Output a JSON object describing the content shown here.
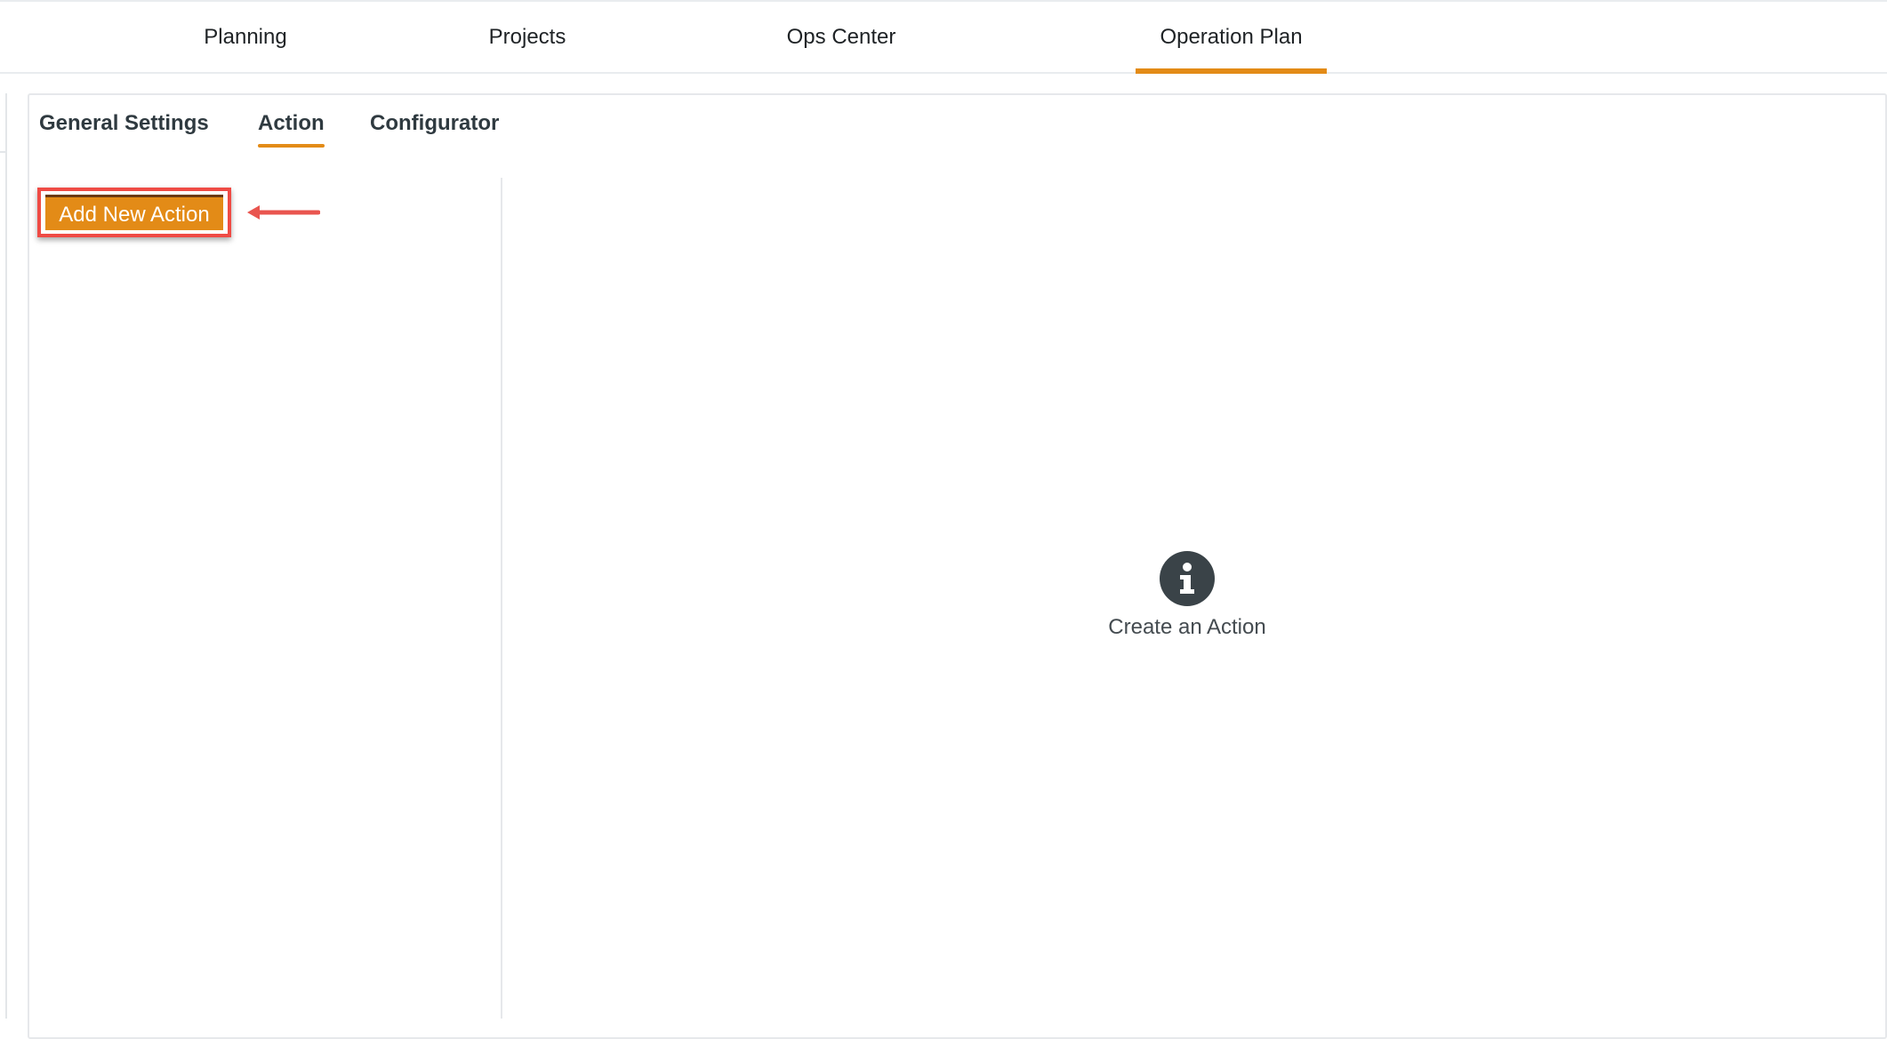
{
  "top_nav": {
    "tabs": [
      {
        "label": "Planning",
        "active": false
      },
      {
        "label": "Projects",
        "active": false
      },
      {
        "label": "Ops Center",
        "active": false
      },
      {
        "label": "Operation Plan",
        "active": true
      }
    ]
  },
  "sub_nav": {
    "tabs": [
      {
        "label": "General Settings",
        "active": false
      },
      {
        "label": "Action",
        "active": true
      },
      {
        "label": "Configurator",
        "active": false
      }
    ]
  },
  "left_pane": {
    "add_button_label": "Add New Action"
  },
  "empty_state": {
    "icon": "info-icon",
    "message": "Create an Action"
  },
  "colors": {
    "accent": "#e38b17",
    "highlight_border": "#ef4b45",
    "icon_bg": "#3a4348"
  }
}
